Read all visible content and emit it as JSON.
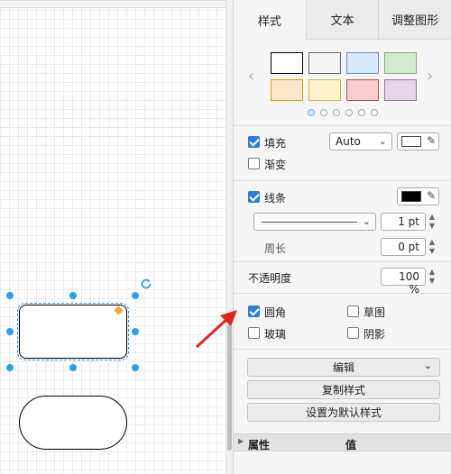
{
  "tabs": [
    {
      "label": "样式",
      "active": true
    },
    {
      "label": "文本",
      "active": false
    },
    {
      "label": "调整图形",
      "active": false
    }
  ],
  "swatches": {
    "colors": [
      {
        "fill": "#ffffff",
        "stroke": "#000000"
      },
      {
        "fill": "#f5f5f5",
        "stroke": "#666666"
      },
      {
        "fill": "#dae8fc",
        "stroke": "#6c8ebf"
      },
      {
        "fill": "#d5e8d4",
        "stroke": "#82b366"
      },
      {
        "fill": "#ffe6cc",
        "stroke": "#d79b00"
      },
      {
        "fill": "#fff2cc",
        "stroke": "#d6b656"
      },
      {
        "fill": "#f8cecc",
        "stroke": "#b85450"
      },
      {
        "fill": "#e1d5e7",
        "stroke": "#9673a6"
      }
    ],
    "pages": 6,
    "active_page": 1
  },
  "fill": {
    "label": "填充",
    "checked": true,
    "mode": "Auto",
    "color": "#ffffff"
  },
  "gradient": {
    "label": "渐变",
    "checked": false
  },
  "line": {
    "label": "线条",
    "checked": true,
    "color": "#000000",
    "width": "1 pt"
  },
  "perimeter": {
    "label": "周长",
    "value": "0 pt"
  },
  "opacity": {
    "label": "不透明度",
    "value": "100 %"
  },
  "options": {
    "rounded": {
      "label": "圆角",
      "checked": true
    },
    "sketch": {
      "label": "草图",
      "checked": false
    },
    "glass": {
      "label": "玻璃",
      "checked": false
    },
    "shadow": {
      "label": "阴影",
      "checked": false
    }
  },
  "actions": {
    "edit": "编辑",
    "copy_style": "复制样式",
    "set_default": "设置为默认样式"
  },
  "properties": {
    "col_property": "属性",
    "col_value": "值"
  },
  "colors": {
    "selection": "#29a1f2",
    "accent": "#2d7fd3",
    "annotation": "#e0261e"
  }
}
